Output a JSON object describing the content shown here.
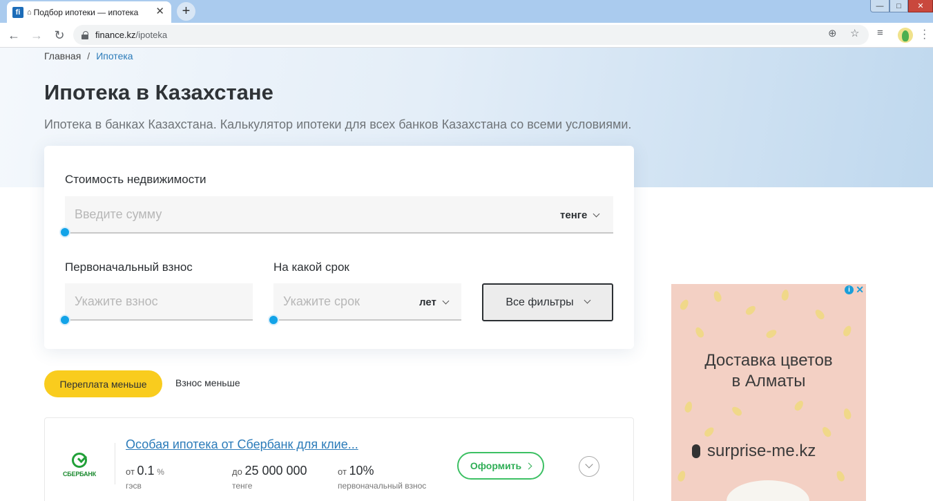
{
  "browser": {
    "tab_title": "Подбор ипотеки — ипотека",
    "favicon_text": "fi",
    "url_domain": "finance.kz",
    "url_path": "/ipoteka"
  },
  "breadcrumb": {
    "home": "Главная",
    "separator": "/",
    "current": "Ипотека"
  },
  "page": {
    "title": "Ипотека в Казахстане",
    "subtitle": "Ипотека в банках Казахстана. Калькулятор ипотеки для всех банков Казахстана со всеми условиями."
  },
  "calculator": {
    "price_label": "Стоимость недвижимости",
    "price_placeholder": "Введите сумму",
    "price_unit": "тенге",
    "down_label": "Первоначальный взнос",
    "down_placeholder": "Укажите взнос",
    "term_label": "На какой срок",
    "term_placeholder": "Укажите срок",
    "term_unit": "лет",
    "filters_button": "Все фильтры"
  },
  "sort": {
    "active": "Переплата меньше",
    "other": "Взнос меньше"
  },
  "offer": {
    "bank_name": "СБЕРБАНК",
    "title": "Особая ипотека от Сбербанк для клие...",
    "rate_prefix": "от",
    "rate_value": "0.1",
    "rate_unit": "%",
    "rate_caption": "гэсв",
    "amount_prefix": "до",
    "amount_value": "25 000 000",
    "amount_caption": "тенге",
    "down_prefix": "от",
    "down_value": "10%",
    "down_caption": "первоначальный взнос",
    "apply_button": "Оформить"
  },
  "ad": {
    "headline_line1": "Доставка цветов",
    "headline_line2": "в Алматы",
    "domain": "surprise-me.kz"
  }
}
